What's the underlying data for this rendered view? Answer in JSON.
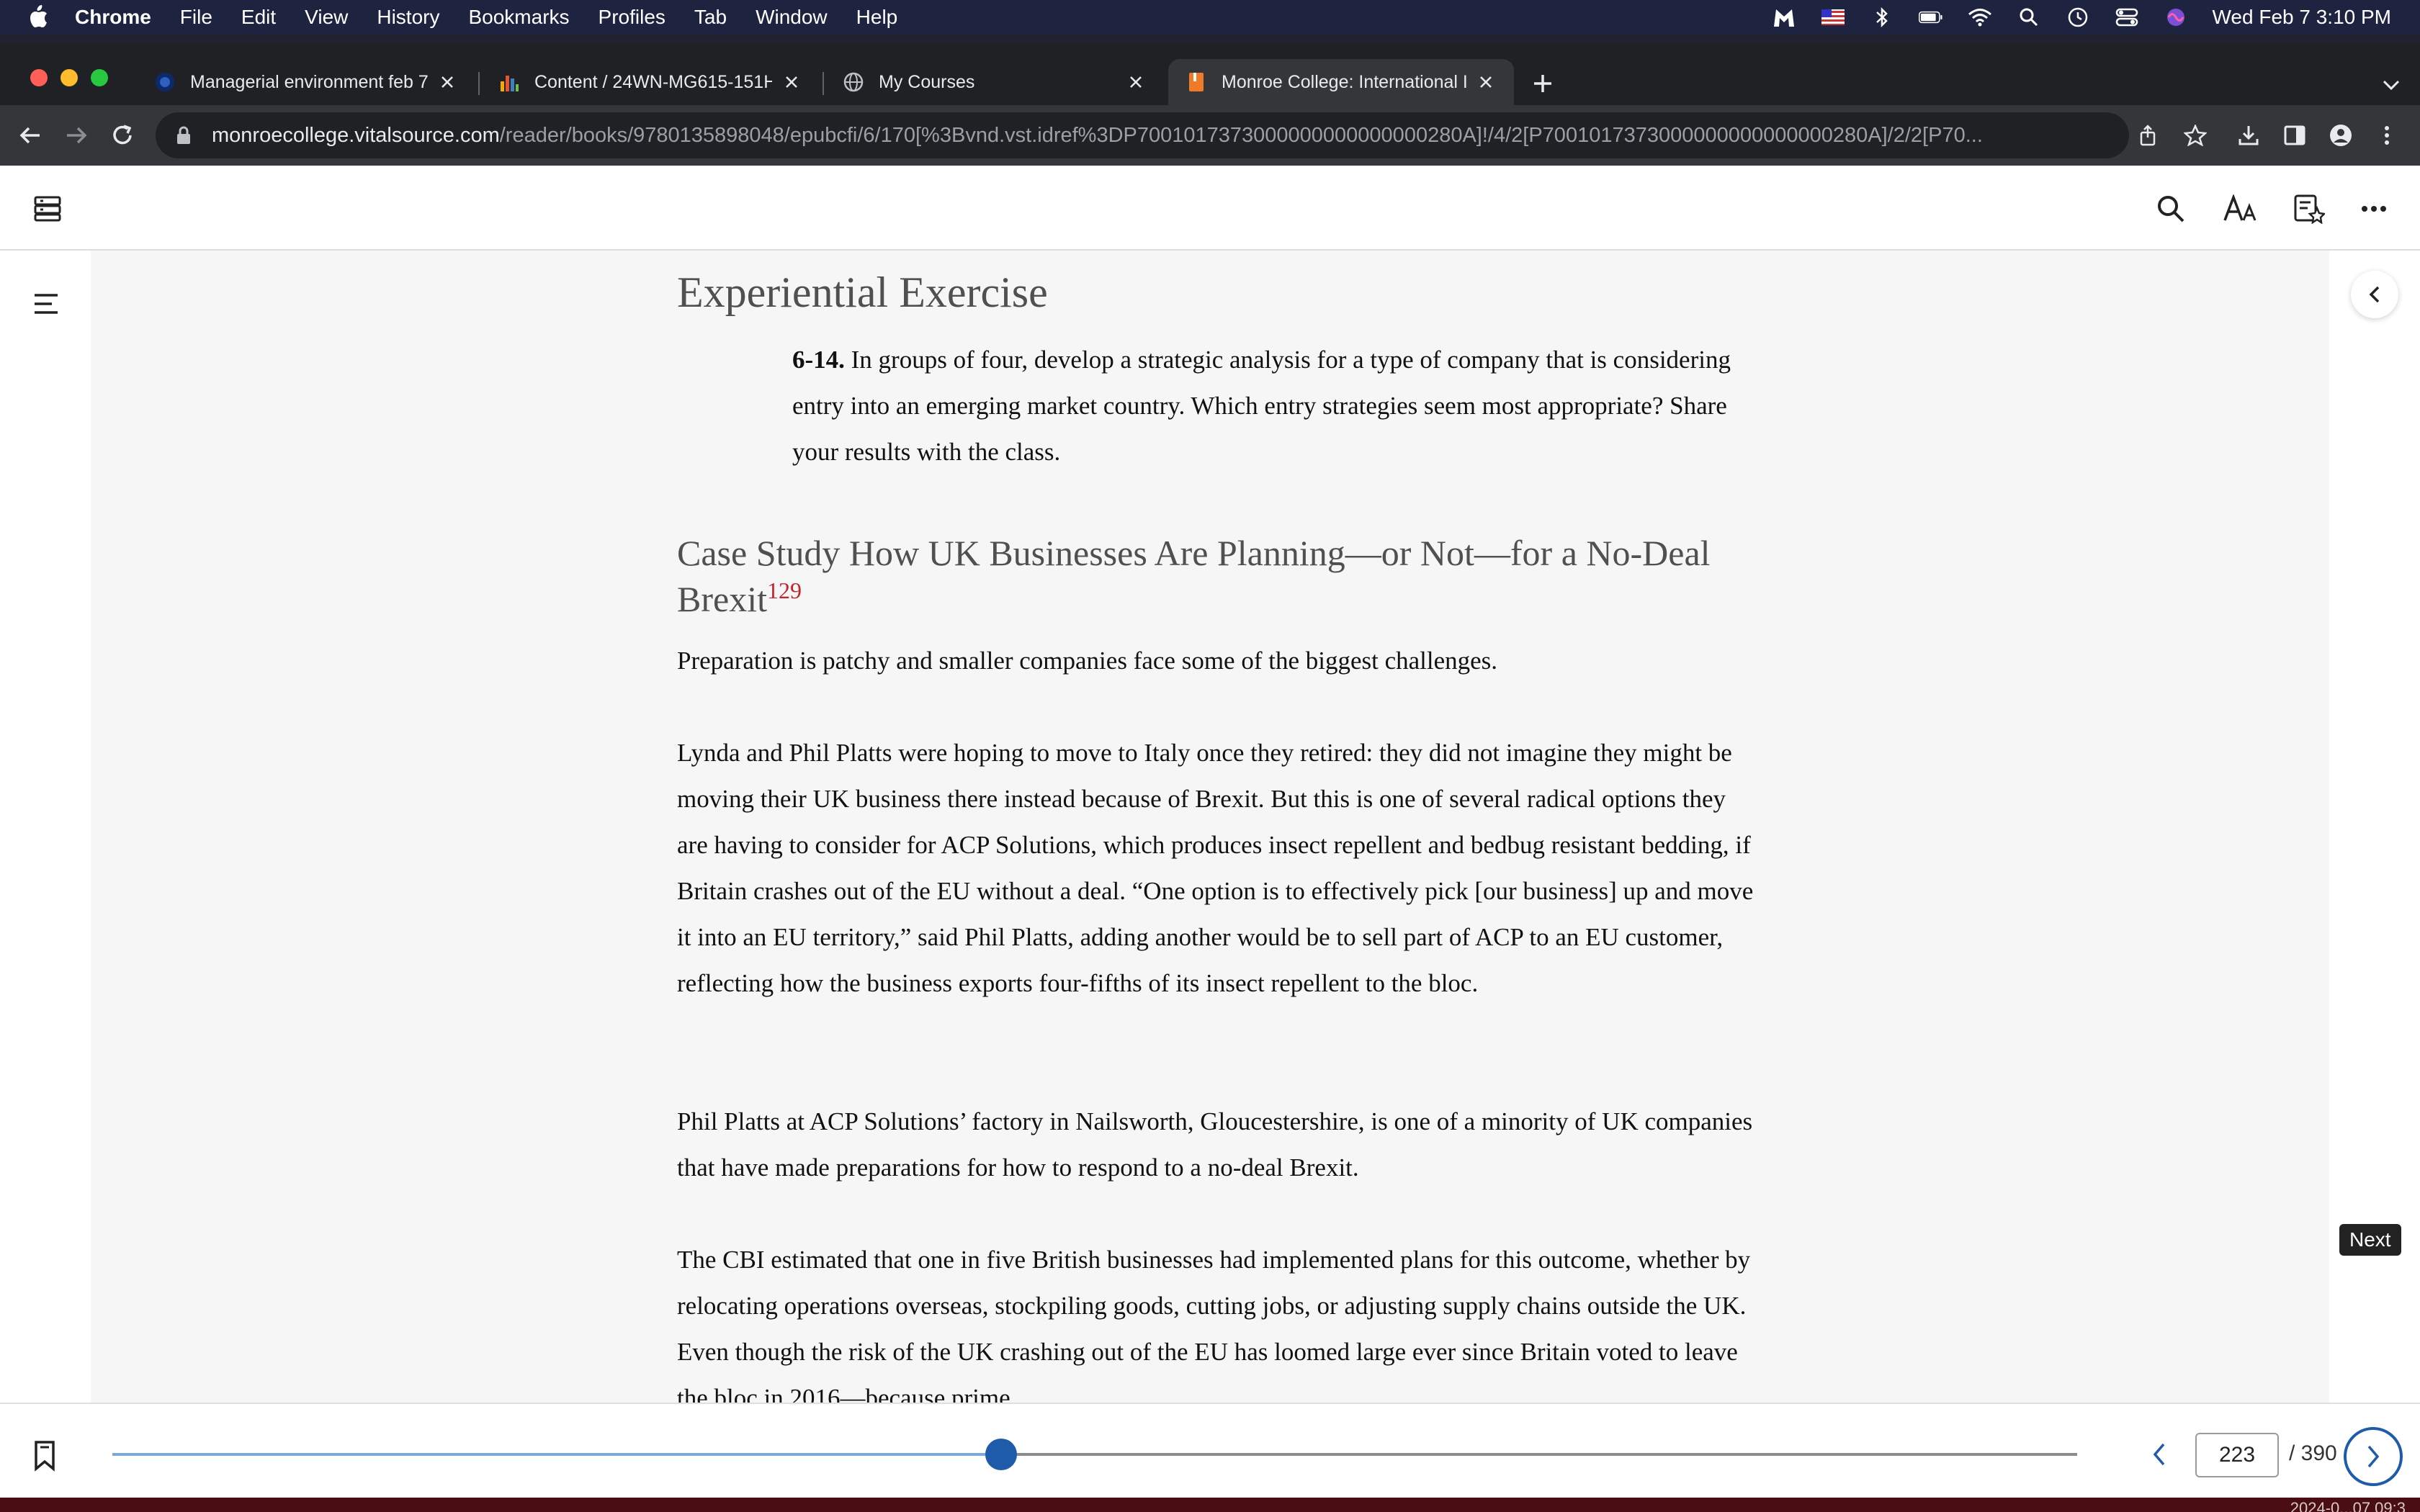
{
  "menubar": {
    "app": "Chrome",
    "items": [
      "File",
      "Edit",
      "View",
      "History",
      "Bookmarks",
      "Profiles",
      "Tab",
      "Window",
      "Help"
    ],
    "clock": "Wed Feb 7  3:10 PM"
  },
  "tabs": [
    {
      "title": "Managerial environment feb 7 |",
      "icon": "circle-logo-icon"
    },
    {
      "title": "Content / 24WN-MG615-151HY",
      "icon": "bar-chart-icon"
    },
    {
      "title": "My Courses",
      "icon": "globe-icon"
    },
    {
      "title": "Monroe College: International I",
      "icon": "book-icon",
      "active": true
    }
  ],
  "address": {
    "host": "monroecollege.vitalsource.com",
    "path": "/reader/books/9780135898048/epubcfi/6/170[%3Bvnd.vst.idref%3DP7001017373000000000000000280A]!/4/2[P7001017373000000000000000280A]/2/2[P70..."
  },
  "book": {
    "exercise_heading": "Experiential Exercise",
    "exercise_number": "6-14.",
    "exercise_text": " In groups of four, develop a strategic analysis for a type of company that is considering entry into an emerging market country. Which entry strategies seem most appropriate? Share your results with the class.",
    "case_heading": "Case Study How UK Businesses Are Planning—or Not—for a No-Deal Brexit",
    "case_footnote": "129",
    "paragraphs": [
      "Preparation is patchy and smaller companies face some of the biggest challenges.",
      "Lynda and Phil Platts were hoping to move to Italy once they retired: they did not imagine they might be moving their UK business there instead because of Brexit. But this is one of several radical options they are having to consider for ACP Solutions, which produces insect repellent and bedbug resistant bedding, if Britain crashes out of the EU without a deal. “One option is to effectively pick [our business] up and move it into an EU territory,” said Phil Platts, adding another would be to sell part of ACP to an EU customer, reflecting how the business exports four-fifths of its insect repellent to the bloc.",
      "Phil Platts at ACP Solutions’ factory in Nailsworth, Gloucestershire, is one of a minority of UK companies that have made preparations for how to respond to a no-deal Brexit.",
      "The CBI estimated that one in five British businesses had implemented plans for this outcome, whether by relocating operations overseas, stockpiling goods, cutting jobs, or adjusting supply chains outside the UK. Even though the risk of the UK crashing out of the EU has loomed large ever since Britain voted to leave the bloc in 2016—because prime"
    ]
  },
  "footer": {
    "current_page": "223",
    "total_pages": "/ 390",
    "progress_fraction": 0.4525,
    "next_tooltip": "Next"
  },
  "bottom_text": "2024-0...07 09:3",
  "colors": {
    "accent": "#1e5ba8",
    "footnote": "#c0262d"
  }
}
